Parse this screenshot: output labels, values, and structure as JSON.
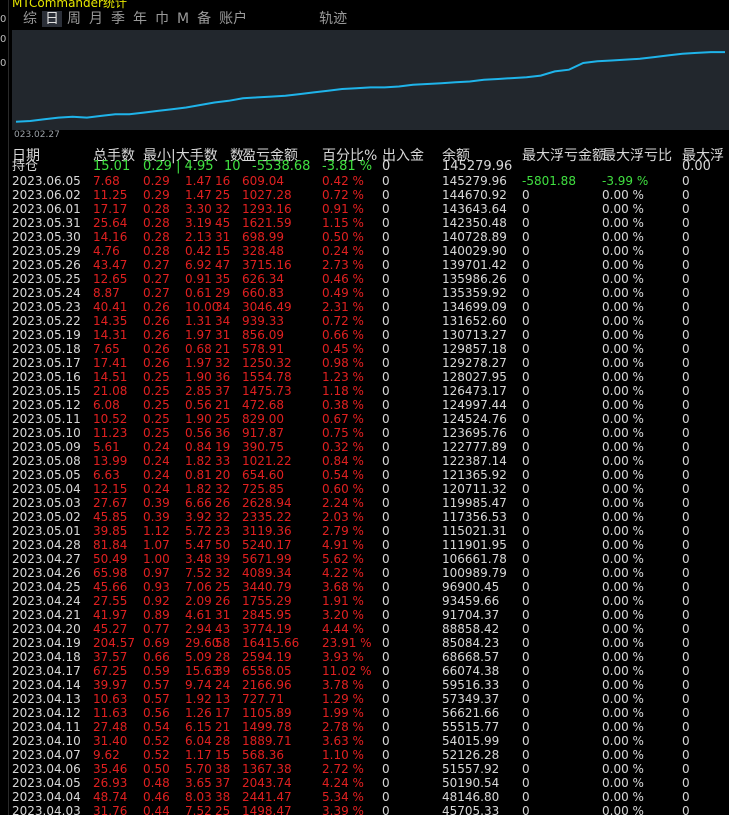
{
  "window": {
    "title": "MTCommander统计"
  },
  "left_ticks": [
    "0",
    "0",
    "0"
  ],
  "tabs": [
    {
      "label": "综"
    },
    {
      "label": "日",
      "active": true
    },
    {
      "label": "周"
    },
    {
      "label": "月"
    },
    {
      "label": "季"
    },
    {
      "label": "年"
    },
    {
      "label": "巾"
    },
    {
      "label": "M"
    },
    {
      "label": "备"
    },
    {
      "label": "账户"
    },
    {
      "label": "轨迹",
      "gap": true
    }
  ],
  "chart_data": {
    "type": "line",
    "x_start_label": "023.02.27",
    "color": "#1fb4ea",
    "background": "#22272d",
    "y": [
      5,
      6,
      8,
      10,
      11,
      10,
      12,
      14,
      14,
      16,
      18,
      20,
      22,
      25,
      28,
      30,
      33,
      34,
      35,
      36,
      38,
      40,
      42,
      44,
      45,
      46,
      46,
      47,
      49,
      50,
      51,
      52,
      53,
      55,
      56,
      57,
      58,
      60,
      65,
      67,
      75,
      77,
      78,
      79,
      80,
      82,
      84,
      86,
      87,
      88,
      88
    ]
  },
  "table": {
    "headers": [
      "日期",
      "总手数",
      "最小|大手数",
      "数",
      "盈亏金额",
      "百分比%",
      "出入金",
      "余额",
      "最大浮亏金额",
      "最大浮亏比",
      "最大浮"
    ],
    "holding": {
      "label": "持仓",
      "lots": "15.01",
      "minmax": "0.29 | 4.95",
      "count": "10",
      "pl": "-5538.68",
      "pct": "-3.81 %",
      "flow": "0",
      "balance": "145279.96",
      "maxloss": "",
      "maxloss_pct": "",
      "last": "0.00"
    },
    "rows": [
      {
        "date": "2023.06.05",
        "lots": "7.68",
        "min": "0.29",
        "max": "1.47",
        "count": "16",
        "pl": "609.04",
        "pct": "0.42 %",
        "flow": "0",
        "balance": "145279.96",
        "maxloss": "-5801.88",
        "maxloss_pct": "-3.99 %",
        "last": "0",
        "hl": true
      },
      {
        "date": "2023.06.02",
        "lots": "11.25",
        "min": "0.29",
        "max": "1.47",
        "count": "25",
        "pl": "1027.28",
        "pct": "0.72 %",
        "flow": "0",
        "balance": "144670.92",
        "maxloss": "0",
        "maxloss_pct": "0.00 %",
        "last": "0"
      },
      {
        "date": "2023.06.01",
        "lots": "17.17",
        "min": "0.28",
        "max": "3.30",
        "count": "32",
        "pl": "1293.16",
        "pct": "0.91 %",
        "flow": "0",
        "balance": "143643.64",
        "maxloss": "0",
        "maxloss_pct": "0.00 %",
        "last": "0"
      },
      {
        "date": "2023.05.31",
        "lots": "25.64",
        "min": "0.28",
        "max": "3.19",
        "count": "45",
        "pl": "1621.59",
        "pct": "1.15 %",
        "flow": "0",
        "balance": "142350.48",
        "maxloss": "0",
        "maxloss_pct": "0.00 %",
        "last": "0"
      },
      {
        "date": "2023.05.30",
        "lots": "14.16",
        "min": "0.28",
        "max": "2.13",
        "count": "31",
        "pl": "698.99",
        "pct": "0.50 %",
        "flow": "0",
        "balance": "140728.89",
        "maxloss": "0",
        "maxloss_pct": "0.00 %",
        "last": "0"
      },
      {
        "date": "2023.05.29",
        "lots": "4.76",
        "min": "0.28",
        "max": "0.42",
        "count": "15",
        "pl": "328.48",
        "pct": "0.24 %",
        "flow": "0",
        "balance": "140029.90",
        "maxloss": "0",
        "maxloss_pct": "0.00 %",
        "last": "0"
      },
      {
        "date": "2023.05.26",
        "lots": "43.47",
        "min": "0.27",
        "max": "6.92",
        "count": "47",
        "pl": "3715.16",
        "pct": "2.73 %",
        "flow": "0",
        "balance": "139701.42",
        "maxloss": "0",
        "maxloss_pct": "0.00 %",
        "last": "0"
      },
      {
        "date": "2023.05.25",
        "lots": "12.65",
        "min": "0.27",
        "max": "0.91",
        "count": "35",
        "pl": "626.34",
        "pct": "0.46 %",
        "flow": "0",
        "balance": "135986.26",
        "maxloss": "0",
        "maxloss_pct": "0.00 %",
        "last": "0"
      },
      {
        "date": "2023.05.24",
        "lots": "8.87",
        "min": "0.27",
        "max": "0.61",
        "count": "29",
        "pl": "660.83",
        "pct": "0.49 %",
        "flow": "0",
        "balance": "135359.92",
        "maxloss": "0",
        "maxloss_pct": "0.00 %",
        "last": "0"
      },
      {
        "date": "2023.05.23",
        "lots": "40.41",
        "min": "0.26",
        "max": "10.00",
        "count": "34",
        "pl": "3046.49",
        "pct": "2.31 %",
        "flow": "0",
        "balance": "134699.09",
        "maxloss": "0",
        "maxloss_pct": "0.00 %",
        "last": "0"
      },
      {
        "date": "2023.05.22",
        "lots": "14.35",
        "min": "0.26",
        "max": "1.31",
        "count": "34",
        "pl": "939.33",
        "pct": "0.72 %",
        "flow": "0",
        "balance": "131652.60",
        "maxloss": "0",
        "maxloss_pct": "0.00 %",
        "last": "0"
      },
      {
        "date": "2023.05.19",
        "lots": "14.31",
        "min": "0.26",
        "max": "1.97",
        "count": "31",
        "pl": "856.09",
        "pct": "0.66 %",
        "flow": "0",
        "balance": "130713.27",
        "maxloss": "0",
        "maxloss_pct": "0.00 %",
        "last": "0"
      },
      {
        "date": "2023.05.18",
        "lots": "7.65",
        "min": "0.26",
        "max": "0.68",
        "count": "21",
        "pl": "578.91",
        "pct": "0.45 %",
        "flow": "0",
        "balance": "129857.18",
        "maxloss": "0",
        "maxloss_pct": "0.00 %",
        "last": "0"
      },
      {
        "date": "2023.05.17",
        "lots": "17.41",
        "min": "0.26",
        "max": "1.97",
        "count": "32",
        "pl": "1250.32",
        "pct": "0.98 %",
        "flow": "0",
        "balance": "129278.27",
        "maxloss": "0",
        "maxloss_pct": "0.00 %",
        "last": "0"
      },
      {
        "date": "2023.05.16",
        "lots": "14.51",
        "min": "0.25",
        "max": "1.90",
        "count": "36",
        "pl": "1554.78",
        "pct": "1.23 %",
        "flow": "0",
        "balance": "128027.95",
        "maxloss": "0",
        "maxloss_pct": "0.00 %",
        "last": "0"
      },
      {
        "date": "2023.05.15",
        "lots": "21.08",
        "min": "0.25",
        "max": "2.85",
        "count": "37",
        "pl": "1475.73",
        "pct": "1.18 %",
        "flow": "0",
        "balance": "126473.17",
        "maxloss": "0",
        "maxloss_pct": "0.00 %",
        "last": "0"
      },
      {
        "date": "2023.05.12",
        "lots": "6.08",
        "min": "0.25",
        "max": "0.56",
        "count": "21",
        "pl": "472.68",
        "pct": "0.38 %",
        "flow": "0",
        "balance": "124997.44",
        "maxloss": "0",
        "maxloss_pct": "0.00 %",
        "last": "0"
      },
      {
        "date": "2023.05.11",
        "lots": "10.52",
        "min": "0.25",
        "max": "1.90",
        "count": "25",
        "pl": "829.00",
        "pct": "0.67 %",
        "flow": "0",
        "balance": "124524.76",
        "maxloss": "0",
        "maxloss_pct": "0.00 %",
        "last": "0"
      },
      {
        "date": "2023.05.10",
        "lots": "11.23",
        "min": "0.25",
        "max": "0.56",
        "count": "36",
        "pl": "917.87",
        "pct": "0.75 %",
        "flow": "0",
        "balance": "123695.76",
        "maxloss": "0",
        "maxloss_pct": "0.00 %",
        "last": "0"
      },
      {
        "date": "2023.05.09",
        "lots": "5.61",
        "min": "0.24",
        "max": "0.84",
        "count": "19",
        "pl": "390.75",
        "pct": "0.32 %",
        "flow": "0",
        "balance": "122777.89",
        "maxloss": "0",
        "maxloss_pct": "0.00 %",
        "last": "0"
      },
      {
        "date": "2023.05.08",
        "lots": "13.99",
        "min": "0.24",
        "max": "1.82",
        "count": "33",
        "pl": "1021.22",
        "pct": "0.84 %",
        "flow": "0",
        "balance": "122387.14",
        "maxloss": "0",
        "maxloss_pct": "0.00 %",
        "last": "0"
      },
      {
        "date": "2023.05.05",
        "lots": "6.63",
        "min": "0.24",
        "max": "0.81",
        "count": "20",
        "pl": "654.60",
        "pct": "0.54 %",
        "flow": "0",
        "balance": "121365.92",
        "maxloss": "0",
        "maxloss_pct": "0.00 %",
        "last": "0"
      },
      {
        "date": "2023.05.04",
        "lots": "12.15",
        "min": "0.24",
        "max": "1.82",
        "count": "32",
        "pl": "725.85",
        "pct": "0.60 %",
        "flow": "0",
        "balance": "120711.32",
        "maxloss": "0",
        "maxloss_pct": "0.00 %",
        "last": "0"
      },
      {
        "date": "2023.05.03",
        "lots": "27.67",
        "min": "0.39",
        "max": "6.66",
        "count": "26",
        "pl": "2628.94",
        "pct": "2.24 %",
        "flow": "0",
        "balance": "119985.47",
        "maxloss": "0",
        "maxloss_pct": "0.00 %",
        "last": "0"
      },
      {
        "date": "2023.05.02",
        "lots": "45.85",
        "min": "0.39",
        "max": "3.92",
        "count": "32",
        "pl": "2335.22",
        "pct": "2.03 %",
        "flow": "0",
        "balance": "117356.53",
        "maxloss": "0",
        "maxloss_pct": "0.00 %",
        "last": "0"
      },
      {
        "date": "2023.05.01",
        "lots": "39.85",
        "min": "1.12",
        "max": "5.72",
        "count": "23",
        "pl": "3119.36",
        "pct": "2.79 %",
        "flow": "0",
        "balance": "115021.31",
        "maxloss": "0",
        "maxloss_pct": "0.00 %",
        "last": "0"
      },
      {
        "date": "2023.04.28",
        "lots": "81.84",
        "min": "1.07",
        "max": "5.47",
        "count": "50",
        "pl": "5240.17",
        "pct": "4.91 %",
        "flow": "0",
        "balance": "111901.95",
        "maxloss": "0",
        "maxloss_pct": "0.00 %",
        "last": "0"
      },
      {
        "date": "2023.04.27",
        "lots": "50.49",
        "min": "1.00",
        "max": "3.48",
        "count": "39",
        "pl": "5671.99",
        "pct": "5.62 %",
        "flow": "0",
        "balance": "106661.78",
        "maxloss": "0",
        "maxloss_pct": "0.00 %",
        "last": "0"
      },
      {
        "date": "2023.04.26",
        "lots": "65.98",
        "min": "0.97",
        "max": "7.52",
        "count": "32",
        "pl": "4089.34",
        "pct": "4.22 %",
        "flow": "0",
        "balance": "100989.79",
        "maxloss": "0",
        "maxloss_pct": "0.00 %",
        "last": "0"
      },
      {
        "date": "2023.04.25",
        "lots": "45.66",
        "min": "0.93",
        "max": "7.06",
        "count": "25",
        "pl": "3440.79",
        "pct": "3.68 %",
        "flow": "0",
        "balance": "96900.45",
        "maxloss": "0",
        "maxloss_pct": "0.00 %",
        "last": "0"
      },
      {
        "date": "2023.04.24",
        "lots": "27.55",
        "min": "0.92",
        "max": "2.09",
        "count": "26",
        "pl": "1755.29",
        "pct": "1.91 %",
        "flow": "0",
        "balance": "93459.66",
        "maxloss": "0",
        "maxloss_pct": "0.00 %",
        "last": "0"
      },
      {
        "date": "2023.04.21",
        "lots": "41.97",
        "min": "0.89",
        "max": "4.61",
        "count": "31",
        "pl": "2845.95",
        "pct": "3.20 %",
        "flow": "0",
        "balance": "91704.37",
        "maxloss": "0",
        "maxloss_pct": "0.00 %",
        "last": "0"
      },
      {
        "date": "2023.04.20",
        "lots": "45.27",
        "min": "0.77",
        "max": "2.94",
        "count": "43",
        "pl": "3774.19",
        "pct": "4.44 %",
        "flow": "0",
        "balance": "88858.42",
        "maxloss": "0",
        "maxloss_pct": "0.00 %",
        "last": "0"
      },
      {
        "date": "2023.04.19",
        "lots": "204.57",
        "min": "0.69",
        "max": "29.60",
        "count": "58",
        "pl": "16415.66",
        "pct": "23.91 %",
        "flow": "0",
        "balance": "85084.23",
        "maxloss": "0",
        "maxloss_pct": "0.00 %",
        "last": "0"
      },
      {
        "date": "2023.04.18",
        "lots": "37.57",
        "min": "0.66",
        "max": "5.09",
        "count": "28",
        "pl": "2594.19",
        "pct": "3.93 %",
        "flow": "0",
        "balance": "68668.57",
        "maxloss": "0",
        "maxloss_pct": "0.00 %",
        "last": "0"
      },
      {
        "date": "2023.04.17",
        "lots": "67.25",
        "min": "0.59",
        "max": "15.63",
        "count": "39",
        "pl": "6558.05",
        "pct": "11.02 %",
        "flow": "0",
        "balance": "66074.38",
        "maxloss": "0",
        "maxloss_pct": "0.00 %",
        "last": "0"
      },
      {
        "date": "2023.04.14",
        "lots": "39.97",
        "min": "0.57",
        "max": "9.74",
        "count": "24",
        "pl": "2166.96",
        "pct": "3.78 %",
        "flow": "0",
        "balance": "59516.33",
        "maxloss": "0",
        "maxloss_pct": "0.00 %",
        "last": "0"
      },
      {
        "date": "2023.04.13",
        "lots": "10.63",
        "min": "0.57",
        "max": "1.92",
        "count": "13",
        "pl": "727.71",
        "pct": "1.29 %",
        "flow": "0",
        "balance": "57349.37",
        "maxloss": "0",
        "maxloss_pct": "0.00 %",
        "last": "0"
      },
      {
        "date": "2023.04.12",
        "lots": "11.63",
        "min": "0.56",
        "max": "1.26",
        "count": "17",
        "pl": "1105.89",
        "pct": "1.99 %",
        "flow": "0",
        "balance": "56621.66",
        "maxloss": "0",
        "maxloss_pct": "0.00 %",
        "last": "0"
      },
      {
        "date": "2023.04.11",
        "lots": "27.48",
        "min": "0.54",
        "max": "6.15",
        "count": "21",
        "pl": "1499.78",
        "pct": "2.78 %",
        "flow": "0",
        "balance": "55515.77",
        "maxloss": "0",
        "maxloss_pct": "0.00 %",
        "last": "0"
      },
      {
        "date": "2023.04.10",
        "lots": "31.40",
        "min": "0.52",
        "max": "6.04",
        "count": "28",
        "pl": "1889.71",
        "pct": "3.63 %",
        "flow": "0",
        "balance": "54015.99",
        "maxloss": "0",
        "maxloss_pct": "0.00 %",
        "last": "0"
      },
      {
        "date": "2023.04.07",
        "lots": "9.62",
        "min": "0.52",
        "max": "1.17",
        "count": "15",
        "pl": "568.36",
        "pct": "1.10 %",
        "flow": "0",
        "balance": "52126.28",
        "maxloss": "0",
        "maxloss_pct": "0.00 %",
        "last": "0"
      },
      {
        "date": "2023.04.06",
        "lots": "35.46",
        "min": "0.50",
        "max": "5.70",
        "count": "38",
        "pl": "1367.38",
        "pct": "2.72 %",
        "flow": "0",
        "balance": "51557.92",
        "maxloss": "0",
        "maxloss_pct": "0.00 %",
        "last": "0"
      },
      {
        "date": "2023.04.05",
        "lots": "26.93",
        "min": "0.48",
        "max": "3.65",
        "count": "37",
        "pl": "2043.74",
        "pct": "4.24 %",
        "flow": "0",
        "balance": "50190.54",
        "maxloss": "0",
        "maxloss_pct": "0.00 %",
        "last": "0"
      },
      {
        "date": "2023.04.04",
        "lots": "48.74",
        "min": "0.46",
        "max": "8.03",
        "count": "38",
        "pl": "2441.47",
        "pct": "5.34 %",
        "flow": "0",
        "balance": "48146.80",
        "maxloss": "0",
        "maxloss_pct": "0.00 %",
        "last": "0"
      },
      {
        "date": "2023.04.03",
        "lots": "31.76",
        "min": "0.44",
        "max": "7.52",
        "count": "25",
        "pl": "1498.47",
        "pct": "3.39 %",
        "flow": "0",
        "balance": "45705.33",
        "maxloss": "0",
        "maxloss_pct": "0.00 %",
        "last": "0"
      }
    ]
  }
}
